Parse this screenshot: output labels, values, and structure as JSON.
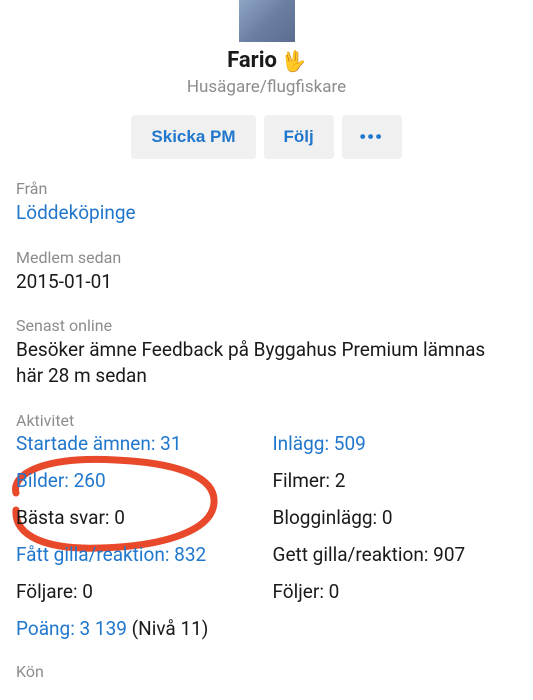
{
  "profile": {
    "username": "Fario",
    "emoji": "🖖",
    "tagline": "Husägare/flugfiskare"
  },
  "buttons": {
    "pm": "Skicka PM",
    "follow": "Följ",
    "more": "•••"
  },
  "info": {
    "from_label": "Från",
    "from_value": "Löddeköpinge",
    "member_since_label": "Medlem sedan",
    "member_since_value": "2015-01-01",
    "last_online_label": "Senast online",
    "last_online_value": "Besöker ämne Feedback på Byggahus Premium lämnas här 28 m sedan",
    "activity_label": "Aktivitet",
    "gender_label": "Kön"
  },
  "activity": {
    "started_topics": "Startade ämnen: 31",
    "posts": "Inlägg: 509",
    "images": "Bilder: 260",
    "videos": "Filmer: 2",
    "best_answers": "Bästa svar: 0",
    "blog_posts": "Blogginlägg: 0",
    "received_likes": "Fått gilla/reaktion: 832",
    "given_likes": "Gett gilla/reaktion: 907",
    "followers": "Följare: 0",
    "following": "Följer: 0",
    "points": "Poäng: 3 139",
    "points_level": " (Nivå 11)"
  }
}
